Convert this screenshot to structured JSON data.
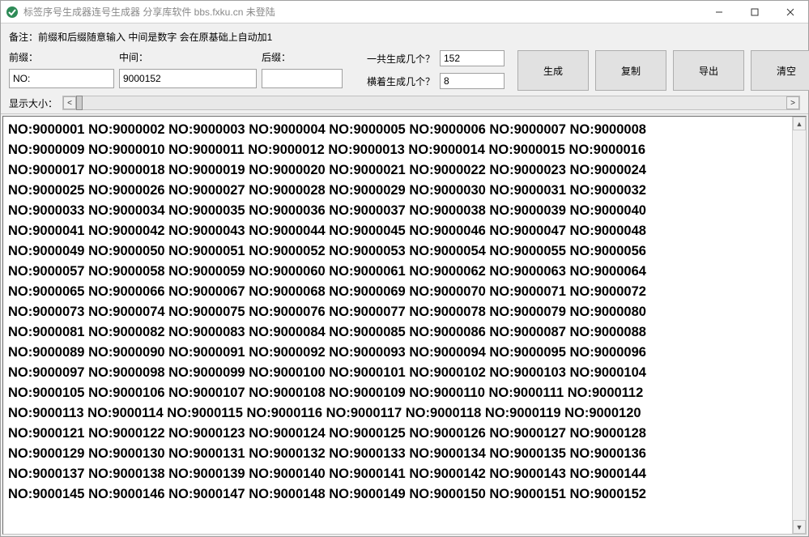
{
  "window": {
    "title": "标签序号生成器连号生成器 分享库软件 bbs.fxku.cn 未登陆"
  },
  "note": "备注：前缀和后缀随意输入    中间是数字   会在原基础上自动加1",
  "labels": {
    "prefix": "前缀：",
    "middle": "中间：",
    "suffix": "后缀：",
    "total": "一共生成几个？",
    "perRow": "横着生成几个？",
    "display": "显示大小："
  },
  "inputs": {
    "prefix": "NO:",
    "middle": "9000152",
    "suffix": "",
    "total": "152",
    "perRow": "8"
  },
  "buttons": {
    "generate": "生成",
    "copy": "复制",
    "export": "导出",
    "clear": "清空"
  },
  "sequence": {
    "prefix": "NO:",
    "start": 9000001,
    "end": 9000152,
    "perRow": 8
  }
}
